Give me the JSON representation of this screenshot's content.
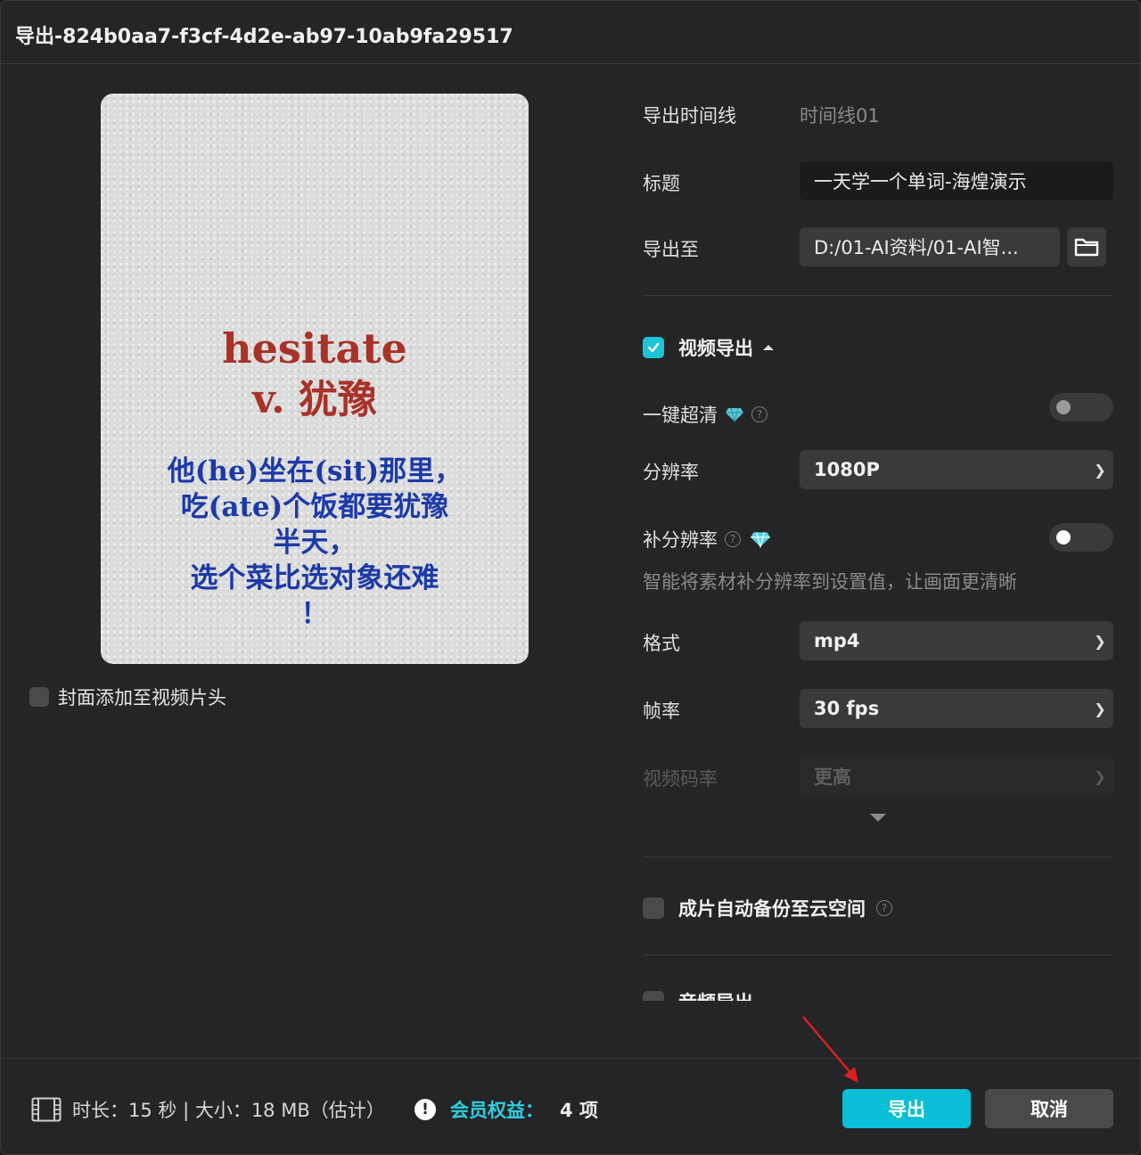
{
  "dialog": {
    "title": "导出-824b0aa7-f3cf-4d2e-ab97-10ab9fa29517"
  },
  "preview": {
    "word": "hesitate",
    "pos": "v. 犹豫",
    "sentence": [
      "他(he)坐在(sit)那里，",
      "吃(ate)个饭都要犹豫",
      "半天，",
      "选个菜比选对象还难",
      "！"
    ]
  },
  "cover": {
    "label": "封面添加至视频片头",
    "checked": false
  },
  "form": {
    "timeline_label": "导出时间线",
    "timeline_value": "时间线01",
    "title_label": "标题",
    "title_value": "一天学一个单词-海煌演示",
    "export_to_label": "导出至",
    "export_to_value": "D:/01-AI资料/01-AI智..."
  },
  "video": {
    "section_label": "视频导出",
    "checked": true,
    "super_hd_label": "一键超清",
    "super_hd_on": false,
    "resolution_label": "分辨率",
    "resolution_value": "1080P",
    "upscale_label": "补分辨率",
    "upscale_on": false,
    "upscale_hint": "智能将素材补分辨率到设置值，让画面更清晰",
    "format_label": "格式",
    "format_value": "mp4",
    "fps_label": "帧率",
    "fps_value": "30 fps",
    "bitrate_label": "视频码率",
    "bitrate_value": "更高"
  },
  "backup": {
    "label": "成片自动备份至云空间",
    "checked": false
  },
  "audio": {
    "label": "音频导出"
  },
  "footer": {
    "info": "时长：15 秒 | 大小：18 MB（估计）",
    "member_label": "会员权益：",
    "member_count": "4 项",
    "export_label": "导出",
    "cancel_label": "取消"
  },
  "colors": {
    "accent": "#08bfd5",
    "word": "#a83227",
    "sentence": "#1b3aa8"
  }
}
